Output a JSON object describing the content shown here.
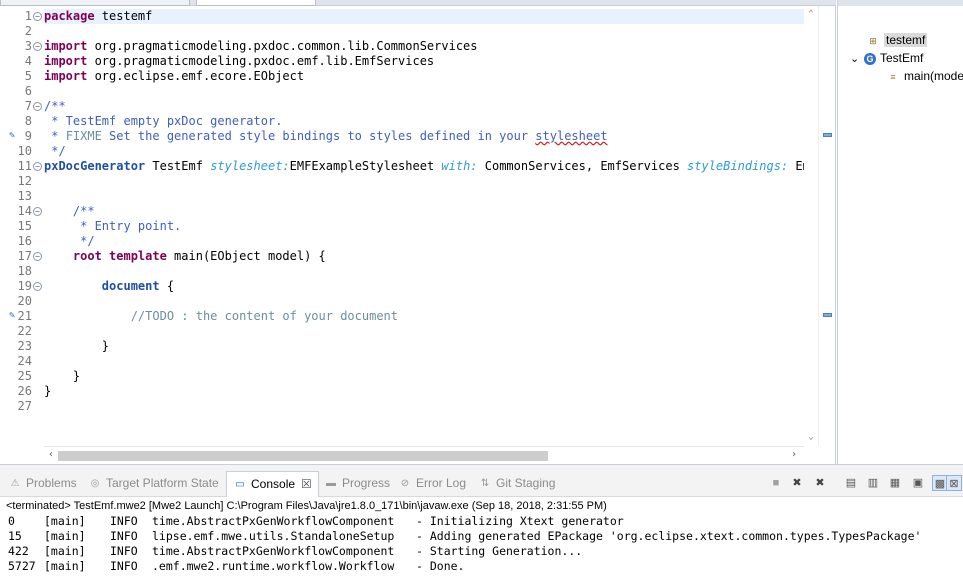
{
  "editor": {
    "lines": [
      {
        "num": "1",
        "fold": true,
        "current": true,
        "segments": [
          {
            "t": "package",
            "c": "kw"
          },
          {
            "t": " testemf",
            "c": "plain"
          }
        ]
      },
      {
        "num": "2",
        "segments": []
      },
      {
        "num": "3",
        "fold": true,
        "segments": [
          {
            "t": "import",
            "c": "kw"
          },
          {
            "t": " org.pragmaticmodeling.pxdoc.common.lib.CommonServices",
            "c": "plain"
          }
        ]
      },
      {
        "num": "4",
        "segments": [
          {
            "t": "import",
            "c": "kw"
          },
          {
            "t": " org.pragmaticmodeling.pxdoc.emf.lib.EmfServices",
            "c": "plain"
          }
        ]
      },
      {
        "num": "5",
        "segments": [
          {
            "t": "import",
            "c": "kw"
          },
          {
            "t": " org.eclipse.emf.ecore.EObject",
            "c": "plain"
          }
        ]
      },
      {
        "num": "6",
        "segments": []
      },
      {
        "num": "7",
        "fold": true,
        "segments": [
          {
            "t": "/**",
            "c": "cm-doc"
          }
        ]
      },
      {
        "num": "8",
        "segments": [
          {
            "t": " * TestEmf empty pxDoc generator.",
            "c": "cm-doc"
          }
        ]
      },
      {
        "num": "9",
        "task": true,
        "segments": [
          {
            "t": " * ",
            "c": "cm-doc"
          },
          {
            "t": "FIXME",
            "c": "todo"
          },
          {
            "t": " Set the generated style bindings to styles defined in your ",
            "c": "cm-doc"
          },
          {
            "t": "stylesheet",
            "c": "cm-doc squiggle"
          }
        ]
      },
      {
        "num": "10",
        "segments": [
          {
            "t": " */",
            "c": "cm-doc"
          }
        ]
      },
      {
        "num": "11",
        "fold": true,
        "segments": [
          {
            "t": "pxDocGenerator",
            "c": "kw2"
          },
          {
            "t": " TestEmf ",
            "c": "plain"
          },
          {
            "t": "stylesheet:",
            "c": "it"
          },
          {
            "t": "EMFExampleStylesheet ",
            "c": "plain"
          },
          {
            "t": "with:",
            "c": "it"
          },
          {
            "t": " CommonServices, EmfServices ",
            "c": "plain"
          },
          {
            "t": "styleBindings:",
            "c": "it"
          },
          {
            "t": " Emph",
            "c": "plain"
          }
        ]
      },
      {
        "num": "12",
        "segments": []
      },
      {
        "num": "13",
        "segments": []
      },
      {
        "num": "14",
        "fold": true,
        "segments": [
          {
            "t": "    /**",
            "c": "cm-doc"
          }
        ]
      },
      {
        "num": "15",
        "segments": [
          {
            "t": "     * Entry point.",
            "c": "cm-doc"
          }
        ]
      },
      {
        "num": "16",
        "segments": [
          {
            "t": "     */",
            "c": "cm-doc"
          }
        ]
      },
      {
        "num": "17",
        "fold": true,
        "segments": [
          {
            "t": "    ",
            "c": "plain"
          },
          {
            "t": "root template",
            "c": "kw"
          },
          {
            "t": " main(EObject model) {",
            "c": "plain"
          }
        ]
      },
      {
        "num": "18",
        "segments": []
      },
      {
        "num": "19",
        "fold": true,
        "segments": [
          {
            "t": "        ",
            "c": "plain"
          },
          {
            "t": "document",
            "c": "kw2"
          },
          {
            "t": " {",
            "c": "plain"
          }
        ]
      },
      {
        "num": "20",
        "segments": []
      },
      {
        "num": "21",
        "task": true,
        "segments": [
          {
            "t": "            //TODO : the content of your document",
            "c": "todo"
          }
        ]
      },
      {
        "num": "22",
        "segments": []
      },
      {
        "num": "23",
        "segments": [
          {
            "t": "        }",
            "c": "plain"
          }
        ]
      },
      {
        "num": "24",
        "segments": []
      },
      {
        "num": "25",
        "segments": [
          {
            "t": "    }",
            "c": "plain"
          }
        ]
      },
      {
        "num": "26",
        "segments": [
          {
            "t": "}",
            "c": "plain"
          }
        ]
      },
      {
        "num": "27",
        "segments": []
      }
    ]
  },
  "outline": {
    "items": [
      {
        "label": "testemf",
        "icon": "package-icon",
        "selected": true,
        "expander": ""
      },
      {
        "label": "TestEmf",
        "icon": "generator-class-icon",
        "selected": false,
        "expander": "⌄"
      },
      {
        "label": "main(mode",
        "icon": "template-icon",
        "selected": false,
        "expander": ""
      }
    ]
  },
  "console": {
    "tabs": [
      {
        "label": "Problems",
        "icon": "problems-icon",
        "active": false
      },
      {
        "label": "Target Platform State",
        "icon": "target-platform-icon",
        "active": false
      },
      {
        "label": "Console",
        "icon": "console-icon",
        "active": true,
        "close": "☒"
      },
      {
        "label": "Progress",
        "icon": "progress-icon",
        "active": false
      },
      {
        "label": "Error Log",
        "icon": "error-log-icon",
        "active": false
      },
      {
        "label": "Git Staging",
        "icon": "git-staging-icon",
        "active": false
      }
    ],
    "toolbar": [
      {
        "name": "terminate-icon",
        "glyph": "■"
      },
      {
        "name": "remove-launch-icon",
        "glyph": "✖"
      },
      {
        "name": "remove-all-terminated-icon",
        "glyph": "✖"
      },
      {
        "name": "clear-console-icon",
        "glyph": "▤"
      },
      {
        "name": "scroll-lock-icon",
        "glyph": "▥"
      },
      {
        "name": "word-wrap-icon",
        "glyph": "▦"
      },
      {
        "name": "pin-console-icon",
        "glyph": "▣"
      },
      {
        "name": "display-selected-console-icon",
        "glyph": "▩"
      },
      {
        "name": "open-console-icon",
        "glyph": "⊠"
      }
    ],
    "terminated_text": "<terminated> TestEmf.mwe2 [Mwe2 Launch] C:\\Program Files\\Java\\jre1.8.0_171\\bin\\javaw.exe (Sep 18, 2018, 2:31:55 PM)",
    "lines": [
      {
        "num": "0",
        "thread": "[main]",
        "level": "INFO",
        "cls": "time.AbstractPxGenWorkflowComponent",
        "msg": "- Initializing Xtext generator"
      },
      {
        "num": "15",
        "thread": "[main]",
        "level": "INFO",
        "cls": "lipse.emf.mwe.utils.StandaloneSetup",
        "msg": "- Adding generated EPackage 'org.eclipse.xtext.common.types.TypesPackage'"
      },
      {
        "num": "422",
        "thread": "[main]",
        "level": "INFO",
        "cls": "time.AbstractPxGenWorkflowComponent",
        "msg": "- Starting Generation..."
      },
      {
        "num": "5727",
        "thread": "[main]",
        "level": "INFO",
        "cls": ".emf.mwe2.runtime.workflow.Workflow",
        "msg": "- Done."
      }
    ]
  }
}
